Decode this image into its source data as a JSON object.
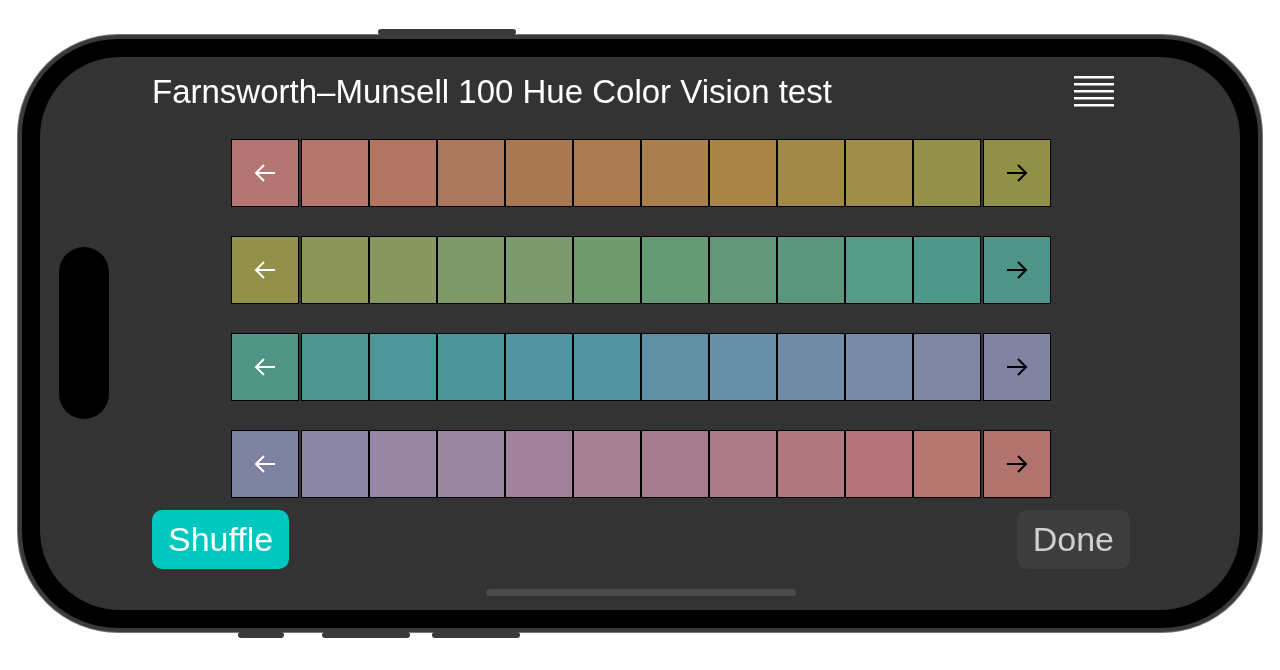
{
  "title": "Farnsworth–Munsell 100 Hue Color Vision test",
  "rows": [
    {
      "left_cap": {
        "color": "#b47672"
      },
      "right_cap": {
        "color": "#909048"
      },
      "chips": [
        {
          "color": "#b3776b"
        },
        {
          "color": "#b07662"
        },
        {
          "color": "#a9775c"
        },
        {
          "color": "#a87853"
        },
        {
          "color": "#a97a4e"
        },
        {
          "color": "#aa7f50"
        },
        {
          "color": "#a98545"
        },
        {
          "color": "#a18a47"
        },
        {
          "color": "#9f8d4a"
        },
        {
          "color": "#959049"
        }
      ]
    },
    {
      "left_cap": {
        "color": "#939049"
      },
      "right_cap": {
        "color": "#4f9488"
      },
      "chips": [
        {
          "color": "#8c9659"
        },
        {
          "color": "#86985f"
        },
        {
          "color": "#7e9a69"
        },
        {
          "color": "#7b9a6d"
        },
        {
          "color": "#6f9a6e"
        },
        {
          "color": "#659a75"
        },
        {
          "color": "#64977a"
        },
        {
          "color": "#5b977f"
        },
        {
          "color": "#559987"
        },
        {
          "color": "#4e9889"
        }
      ]
    },
    {
      "left_cap": {
        "color": "#4f9484"
      },
      "right_cap": {
        "color": "#8083a2"
      },
      "chips": [
        {
          "color": "#4f9690"
        },
        {
          "color": "#4c9898"
        },
        {
          "color": "#4c9599"
        },
        {
          "color": "#5294a0"
        },
        {
          "color": "#5493a2"
        },
        {
          "color": "#5f8fa2"
        },
        {
          "color": "#698ea8"
        },
        {
          "color": "#6f8ba6"
        },
        {
          "color": "#778aa8"
        },
        {
          "color": "#7e86a2"
        }
      ]
    },
    {
      "left_cap": {
        "color": "#7d82a0"
      },
      "right_cap": {
        "color": "#b0736e"
      },
      "chips": [
        {
          "color": "#8c86a5"
        },
        {
          "color": "#9786a4"
        },
        {
          "color": "#9b86a0"
        },
        {
          "color": "#a0829d"
        },
        {
          "color": "#a67f94"
        },
        {
          "color": "#a67d8c"
        },
        {
          "color": "#ab7b87"
        },
        {
          "color": "#b27881"
        },
        {
          "color": "#b57479"
        },
        {
          "color": "#b47772"
        }
      ]
    }
  ],
  "buttons": [
    {
      "label": "Shuffle",
      "disabled": false
    },
    {
      "label": "Done",
      "disabled": true
    }
  ]
}
